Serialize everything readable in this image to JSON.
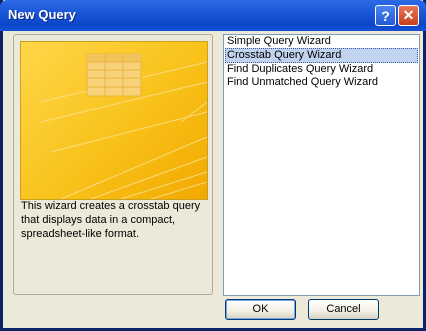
{
  "window": {
    "title": "New Query",
    "help_glyph": "?",
    "close_glyph": "✕"
  },
  "preview": {
    "description": "This wizard creates a crosstab query that displays data in a compact, spreadsheet-like format.",
    "colors": {
      "background": "#F8C21A",
      "grid": "#F5D27A"
    }
  },
  "wizards": {
    "items": [
      {
        "label": "Simple Query Wizard"
      },
      {
        "label": "Crosstab Query Wizard"
      },
      {
        "label": "Find Duplicates Query Wizard"
      },
      {
        "label": "Find Unmatched Query Wizard"
      }
    ],
    "selected": "Crosstab Query Wizard"
  },
  "buttons": {
    "ok_label": "OK",
    "cancel_label": "Cancel"
  }
}
